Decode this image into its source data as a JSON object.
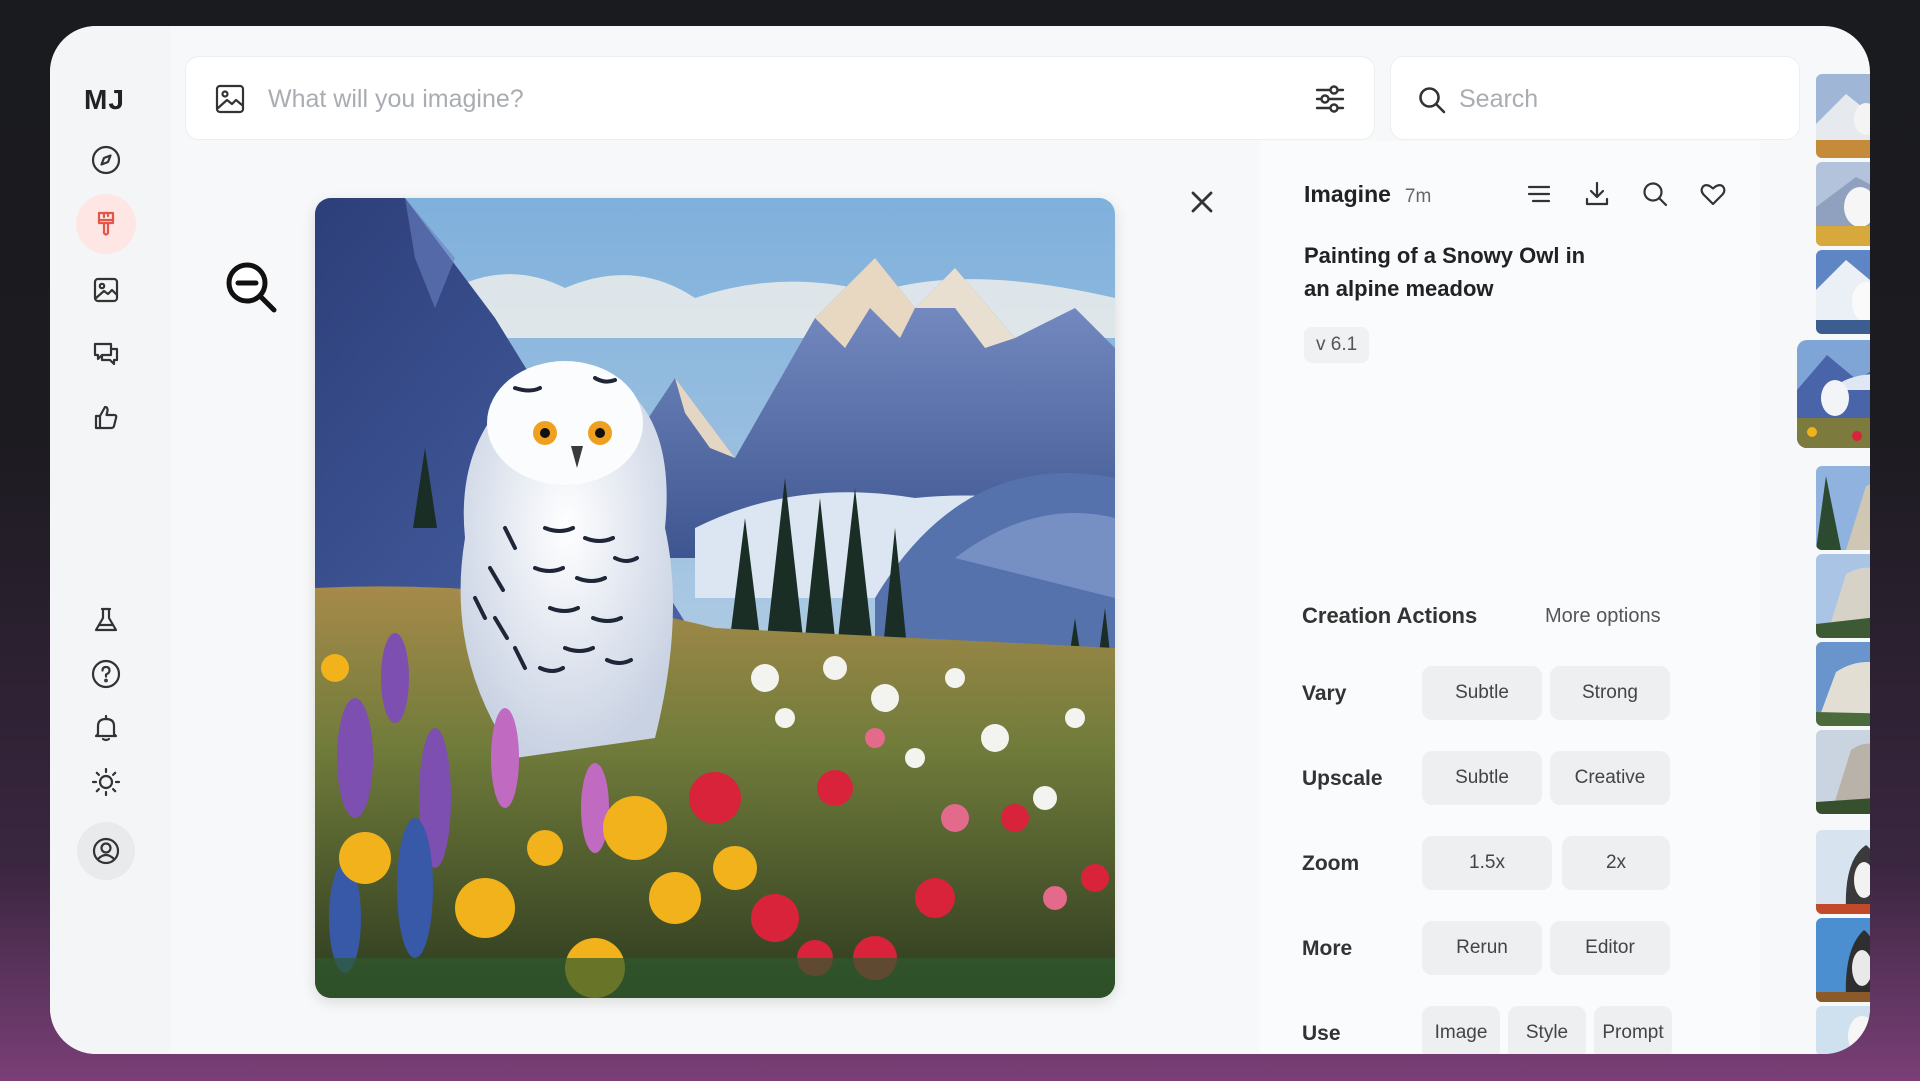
{
  "app": {
    "logo": "MJ"
  },
  "sidebar": {
    "items": [
      {
        "name": "explore",
        "icon": "compass-icon"
      },
      {
        "name": "create",
        "icon": "paintbrush-icon",
        "active": true
      },
      {
        "name": "organize",
        "icon": "image-icon"
      },
      {
        "name": "chat",
        "icon": "chat-icon"
      },
      {
        "name": "rank",
        "icon": "thumbs-up-icon"
      },
      {
        "name": "labs",
        "icon": "flask-icon"
      },
      {
        "name": "help",
        "icon": "help-icon"
      },
      {
        "name": "updates",
        "icon": "bell-icon"
      },
      {
        "name": "theme",
        "icon": "sun-icon"
      },
      {
        "name": "profile",
        "icon": "user-icon"
      }
    ],
    "active_color": "#e4564a"
  },
  "prompt_bar": {
    "placeholder": "What will you imagine?"
  },
  "search": {
    "placeholder": "Search"
  },
  "detail": {
    "title": "Imagine",
    "time": "7m",
    "prompt": "Painting of a Snowy Owl in an alpine meadow",
    "version": "v 6.1"
  },
  "actions": {
    "title": "Creation Actions",
    "more_options": "More options",
    "rows": [
      {
        "label": "Vary",
        "buttons": [
          "Subtle",
          "Strong"
        ]
      },
      {
        "label": "Upscale",
        "buttons": [
          "Subtle",
          "Creative"
        ]
      },
      {
        "label": "Zoom",
        "buttons": [
          "1.5x",
          "2x"
        ]
      },
      {
        "label": "More",
        "buttons": [
          "Rerun",
          "Editor"
        ]
      },
      {
        "label": "Use",
        "buttons": [
          "Image",
          "Style",
          "Prompt"
        ]
      }
    ]
  }
}
